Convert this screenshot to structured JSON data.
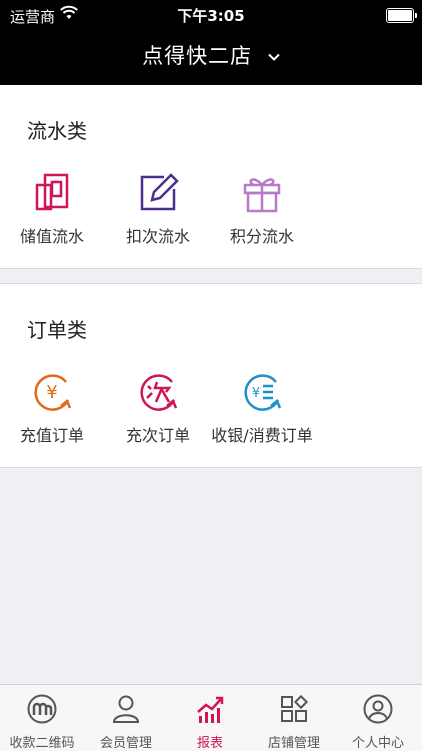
{
  "status_bar": {
    "carrier": "运营商",
    "time": "下午3:05"
  },
  "header": {
    "title": "点得快二店"
  },
  "flow_section": {
    "title": "流水类",
    "items": [
      {
        "label": "储值流水",
        "icon": "ledger-icon",
        "color": "#d0145a"
      },
      {
        "label": "扣次流水",
        "icon": "edit-icon",
        "color": "#4a2f8c"
      },
      {
        "label": "积分流水",
        "icon": "gift-icon",
        "color": "#b77ac9"
      }
    ]
  },
  "order_section": {
    "title": "订单类",
    "items": [
      {
        "label": "充值订单",
        "icon": "yen-refresh-icon",
        "color": "#e06a1a"
      },
      {
        "label": "充次订单",
        "icon": "ci-refresh-icon",
        "color": "#d0145a"
      },
      {
        "label": "收银/消费订单",
        "icon": "cashier-icon",
        "color": "#1f8fc9"
      }
    ]
  },
  "tabbar": {
    "active_color": "#d0145a",
    "items": [
      {
        "label": "收款二维码",
        "icon": "qr-logo-icon"
      },
      {
        "label": "会员管理",
        "icon": "member-icon"
      },
      {
        "label": "报表",
        "icon": "report-icon",
        "active": true
      },
      {
        "label": "店铺管理",
        "icon": "store-icon"
      },
      {
        "label": "个人中心",
        "icon": "profile-icon"
      }
    ]
  }
}
